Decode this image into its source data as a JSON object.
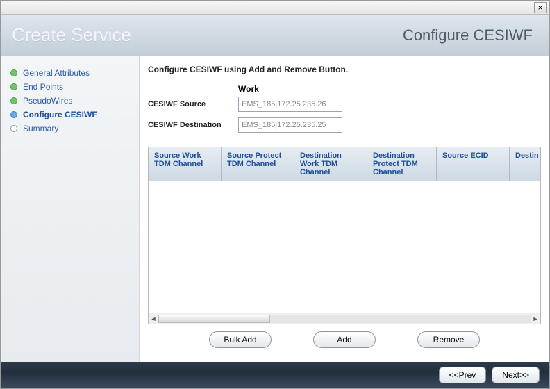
{
  "titlebar": {
    "close": "×"
  },
  "header": {
    "left": "Create Service",
    "right": "Configure CESIWF"
  },
  "sidebar": {
    "items": [
      {
        "label": "General Attributes",
        "state": "done"
      },
      {
        "label": "End Points",
        "state": "done"
      },
      {
        "label": "PseudoWires",
        "state": "done"
      },
      {
        "label": "Configure CESIWF",
        "state": "current"
      },
      {
        "label": "Summary",
        "state": "todo"
      }
    ]
  },
  "main": {
    "instruction": "Configure CESIWF using Add and Remove Button.",
    "work_heading": "Work",
    "source_label": "CESIWF Source",
    "source_value": "EMS_185|172.25.235.26",
    "dest_label": "CESIWF Destination",
    "dest_value": "EMS_185|172.25.235.25"
  },
  "table": {
    "columns": [
      "Source Work TDM Channel",
      "Source Protect TDM Channel",
      "Destination Work TDM Channel",
      "Destination Protect TDM Channel",
      "Source ECID",
      "Destin"
    ]
  },
  "buttons": {
    "bulk_add": "Bulk Add",
    "add": "Add",
    "remove": "Remove",
    "prev": "<<Prev",
    "next": "Next>>"
  }
}
